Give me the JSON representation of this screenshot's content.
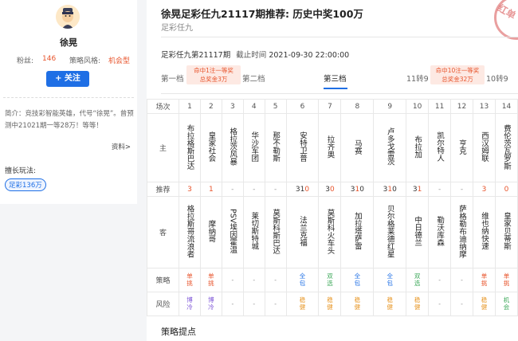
{
  "profile": {
    "name": "徐晃",
    "fans_label": "粉丝:",
    "fans_value": "146",
    "style_label": "策略风格:",
    "style_value": "机会型",
    "follow_label": "+ 关注",
    "bio": "简介：竞技彩智能英雄，代号“徐晃”。曾预测中21021期一等28万！等等！",
    "more_label": "资料>",
    "play_title": "擅长玩法:",
    "play_tag": "足彩136万"
  },
  "article": {
    "title": "徐晃足彩任九21117期推荐: 历史中奖100万",
    "category": "足彩任九",
    "issue": "足彩任九第21117期",
    "deadline_label": "截止时间",
    "deadline": "2021-09-30 22:00:00",
    "stamp": "红单"
  },
  "tabs": {
    "t1": "第一档",
    "t2": "第二档",
    "t3": "第三档",
    "t4": "11转9",
    "t5": "10转9",
    "badge1_line1": "命中1注一等奖",
    "badge1_line2": "总奖金3万",
    "badge2_line1": "命中10注一等奖",
    "badge2_line2": "总奖金32万"
  },
  "table": {
    "labels": {
      "index": "场次",
      "home": "主",
      "recommend": "推荐",
      "away": "客",
      "strategy": "策略",
      "risk": "风险"
    },
    "matches": [
      {
        "n": "1",
        "home": "布拉格斯巴达",
        "rec": [
          {
            "t": "3",
            "c": "red"
          }
        ],
        "away": "格拉斯哥流浪者",
        "strat": "单挑",
        "strat_c": "red",
        "risk": "博冷",
        "risk_c": "purple"
      },
      {
        "n": "2",
        "home": "皇家社会",
        "rec": [
          {
            "t": "1",
            "c": "red"
          }
        ],
        "away": "摩纳哥",
        "strat": "单挑",
        "strat_c": "red",
        "risk": "博冷",
        "risk_c": "purple"
      },
      {
        "n": "3",
        "home": "格拉茨风暴",
        "rec": [
          {
            "t": "-",
            "c": "gray"
          }
        ],
        "away": "PSV埃因霍温",
        "strat": "-",
        "strat_c": "gray",
        "risk": "-",
        "risk_c": "gray"
      },
      {
        "n": "4",
        "home": "华沙军团",
        "rec": [
          {
            "t": "-",
            "c": "gray"
          }
        ],
        "away": "莱切斯特城",
        "strat": "-",
        "strat_c": "gray",
        "risk": "-",
        "risk_c": "gray"
      },
      {
        "n": "5",
        "home": "那不勒斯",
        "rec": [
          {
            "t": "-",
            "c": "gray"
          }
        ],
        "away": "莫斯科斯巴达",
        "strat": "-",
        "strat_c": "gray",
        "risk": "-",
        "risk_c": "gray"
      },
      {
        "n": "6",
        "home": "安特卫普",
        "rec": [
          {
            "t": "3",
            "c": "dark"
          },
          {
            "t": "1",
            "c": "dark"
          },
          {
            "t": "0",
            "c": "red"
          }
        ],
        "away": "法兰克福",
        "strat": "全包",
        "strat_c": "blue",
        "risk": "稳健",
        "risk_c": "orange"
      },
      {
        "n": "7",
        "home": "拉齐奥",
        "rec": [
          {
            "t": "3",
            "c": "dark"
          },
          {
            "t": "0",
            "c": "red"
          }
        ],
        "away": "莫斯科火车头",
        "strat": "双选",
        "strat_c": "green",
        "risk": "稳健",
        "risk_c": "orange"
      },
      {
        "n": "8",
        "home": "马赛",
        "rec": [
          {
            "t": "3",
            "c": "dark"
          },
          {
            "t": "1",
            "c": "red"
          },
          {
            "t": "0",
            "c": "dark"
          }
        ],
        "away": "加拉塔萨雷",
        "strat": "全包",
        "strat_c": "blue",
        "risk": "稳健",
        "risk_c": "orange"
      },
      {
        "n": "9",
        "home": "卢多戈雷茨",
        "rec": [
          {
            "t": "3",
            "c": "dark"
          },
          {
            "t": "1",
            "c": "red"
          },
          {
            "t": "0",
            "c": "dark"
          }
        ],
        "away": "贝尔格莱德红星",
        "strat": "全包",
        "strat_c": "blue",
        "risk": "稳健",
        "risk_c": "orange"
      },
      {
        "n": "10",
        "home": "布拉加",
        "rec": [
          {
            "t": "3",
            "c": "dark"
          },
          {
            "t": "1",
            "c": "red"
          }
        ],
        "away": "中日德兰",
        "strat": "双选",
        "strat_c": "green",
        "risk": "稳健",
        "risk_c": "orange"
      },
      {
        "n": "11",
        "home": "凯尔特人",
        "rec": [
          {
            "t": "-",
            "c": "gray"
          }
        ],
        "away": "勒沃库森",
        "strat": "-",
        "strat_c": "gray",
        "risk": "-",
        "risk_c": "gray"
      },
      {
        "n": "12",
        "home": "亨克",
        "rec": [
          {
            "t": "-",
            "c": "gray"
          }
        ],
        "away": "萨格勒布迪纳摩",
        "strat": "-",
        "strat_c": "gray",
        "risk": "-",
        "risk_c": "gray"
      },
      {
        "n": "13",
        "home": "西汉姆联",
        "rec": [
          {
            "t": "3",
            "c": "red"
          }
        ],
        "away": "维也纳快速",
        "strat": "单挑",
        "strat_c": "red",
        "risk": "稳健",
        "risk_c": "orange"
      },
      {
        "n": "14",
        "home": "费伦茨瓦罗斯",
        "rec": [
          {
            "t": "0",
            "c": "red"
          }
        ],
        "away": "皇家贝蒂斯",
        "strat": "单挑",
        "strat_c": "red",
        "risk": "机会",
        "risk_c": "green"
      }
    ]
  },
  "section_title": "策略提点"
}
